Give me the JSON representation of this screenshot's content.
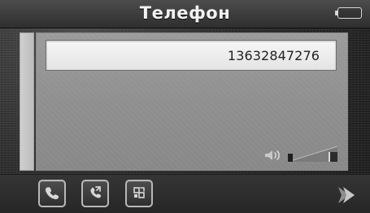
{
  "header": {
    "title": "Телефон",
    "battery_icon": "battery-empty-icon"
  },
  "phone_number": {
    "value": "13632847276"
  },
  "volume": {
    "icon": "speaker-icon",
    "level": 0.12
  },
  "actions": {
    "call_icon": "phone-icon",
    "transfer_icon": "transfer-icon",
    "mute_icon": "mute-icon",
    "next_icon": "next-arrow-icon"
  },
  "colors": {
    "title_text": "#f1f1f1",
    "panel": "#8e8e8e",
    "input_bg": "#f6f6f6",
    "button_border": "#b8b8b8"
  }
}
